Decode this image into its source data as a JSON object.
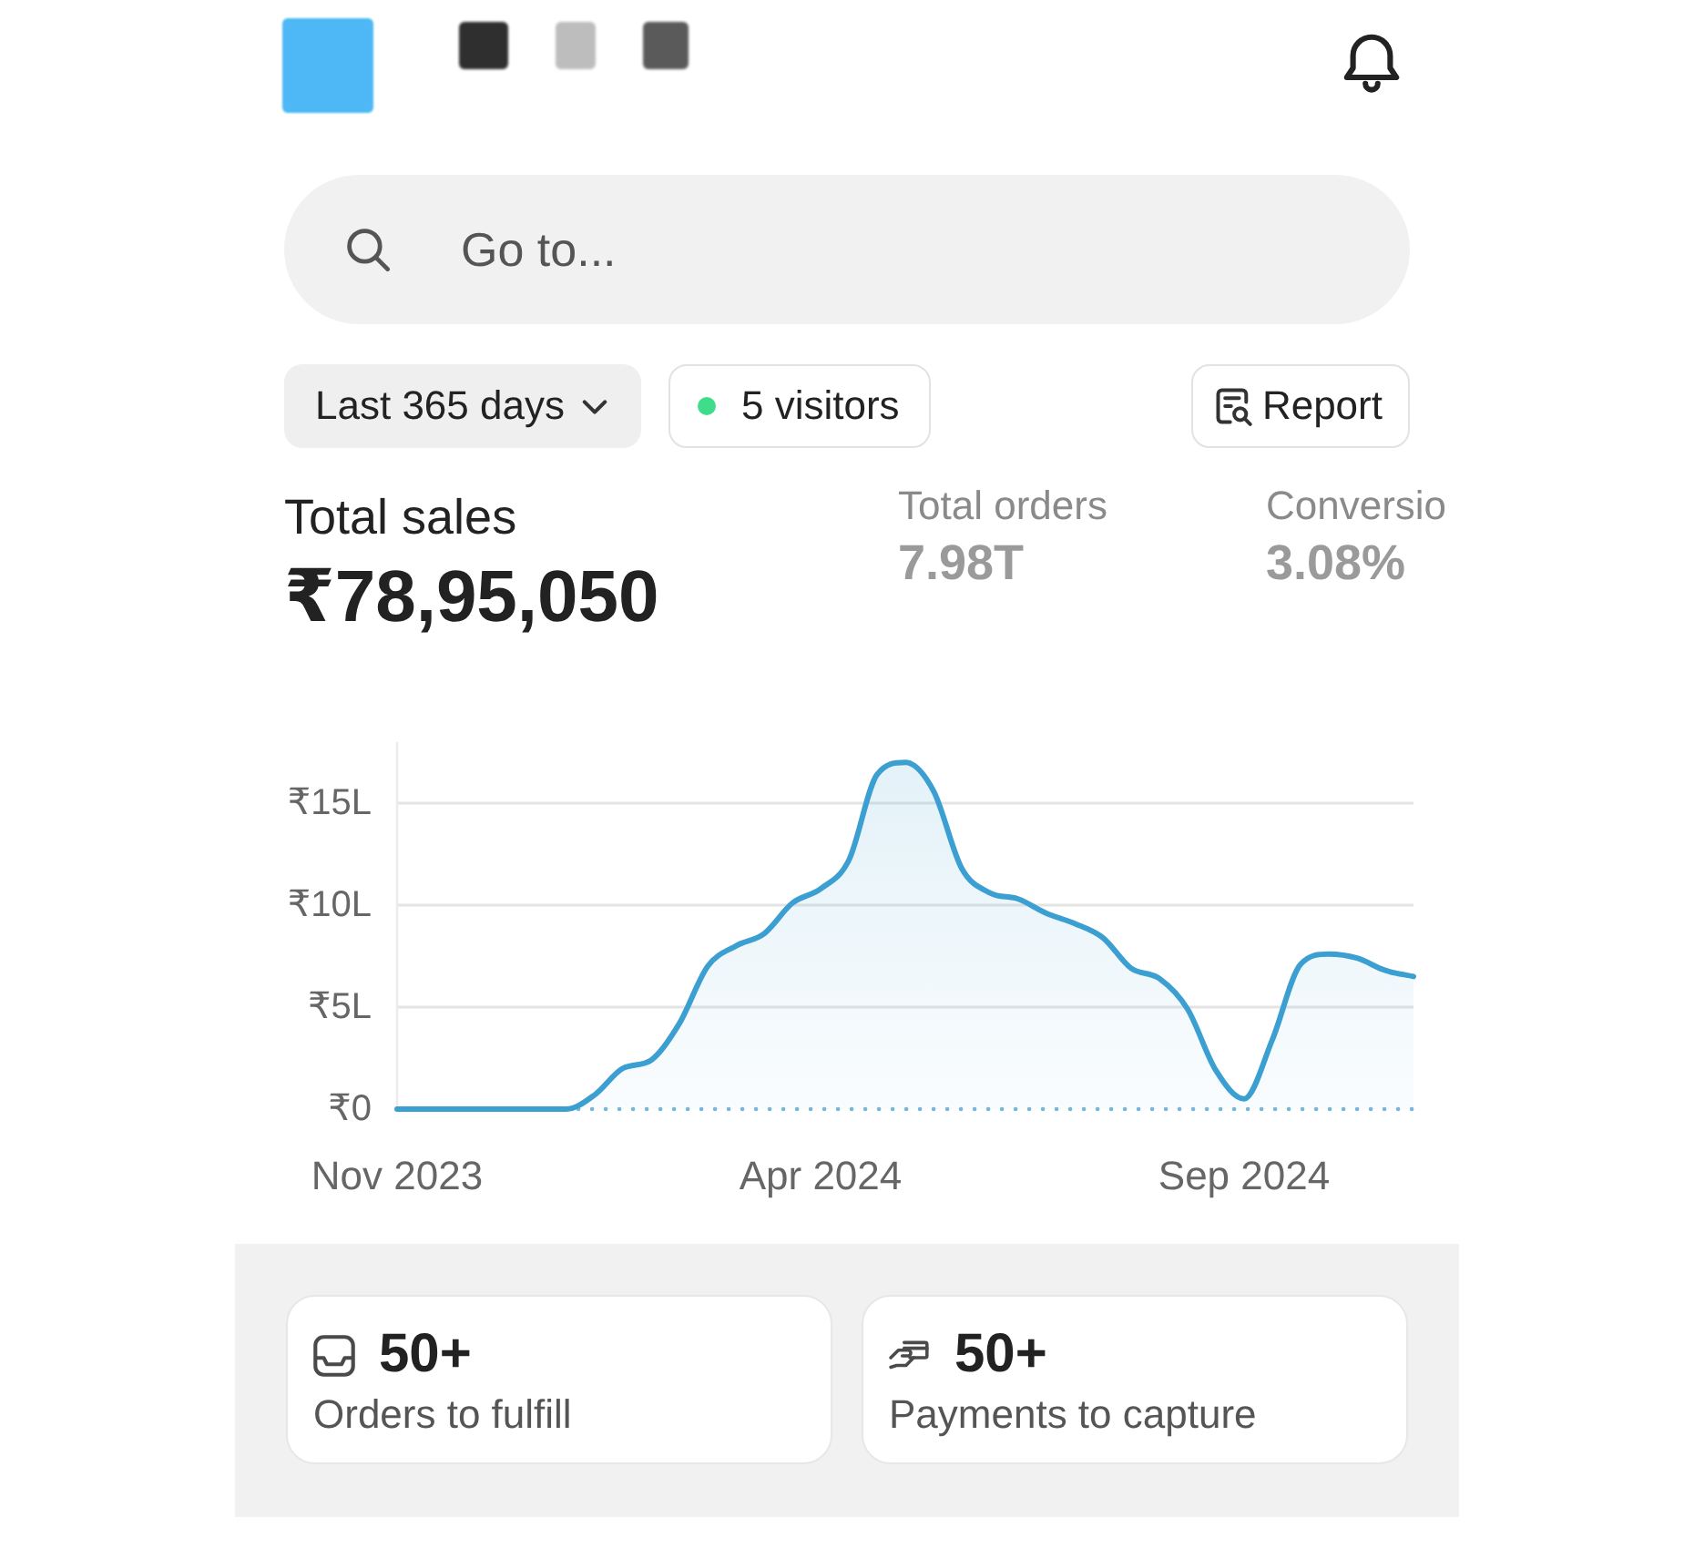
{
  "search": {
    "placeholder": "Go to..."
  },
  "toolbar": {
    "period": "Last 365 days",
    "visitors": "5 visitors",
    "report": "Report"
  },
  "stats": [
    {
      "kind": "primary",
      "label": "Total sales",
      "value": "₹78,95,050"
    },
    {
      "kind": "secondary",
      "label": "Total orders",
      "value": "7.98T"
    },
    {
      "kind": "secondary",
      "label": "Conversio",
      "value": "3.08%"
    }
  ],
  "chart": {
    "chart_data": {
      "type": "area",
      "categories": [
        "Nov 2023",
        null,
        null,
        null,
        null,
        null,
        null,
        null,
        null,
        null,
        null,
        null,
        null,
        null,
        null,
        "Apr 2024",
        null,
        null,
        null,
        null,
        null,
        null,
        null,
        null,
        null,
        null,
        null,
        null,
        null,
        null,
        "Sep 2024",
        null,
        null,
        null,
        null,
        null,
        null
      ],
      "series": [
        {
          "color": "#3b9fd1",
          "values": [
            0,
            0,
            0,
            0,
            0,
            0,
            0,
            0.7,
            2.0,
            2.4,
            4.2,
            7.0,
            8.0,
            8.6,
            10.1,
            10.8,
            12.2,
            16.4,
            17.0,
            15.6,
            11.8,
            10.6,
            10.3,
            9.6,
            9.1,
            8.4,
            6.9,
            6.4,
            4.9,
            1.9,
            0.5,
            3.4,
            7.1,
            7.6,
            7.4,
            6.8,
            6.5
          ]
        }
      ],
      "ylim": [
        0,
        18
      ],
      "yticks": [
        {
          "value": 0,
          "label": "₹0"
        },
        {
          "value": 5,
          "label": "₹5L"
        },
        {
          "value": 10,
          "label": "₹10L"
        },
        {
          "value": 15,
          "label": "₹15L"
        }
      ],
      "grid": true
    }
  },
  "tasks": [
    {
      "kind": "inbox",
      "value": "50+",
      "label": "Orders to fulfill"
    },
    {
      "kind": "payment",
      "value": "50+",
      "label": "Payments to capture"
    }
  ]
}
